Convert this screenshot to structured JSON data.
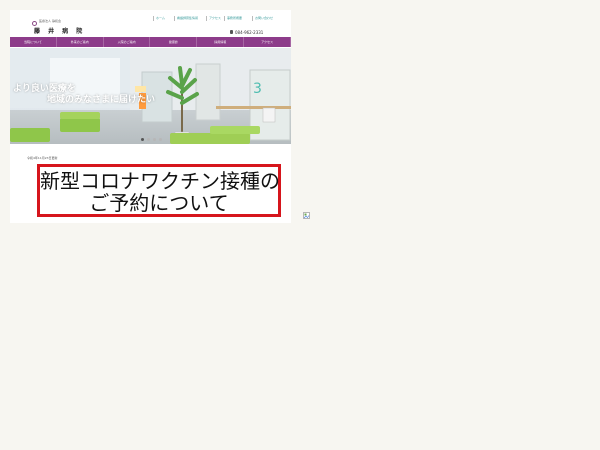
{
  "header": {
    "org_line": "医療法人 静和会",
    "logo_name": "藤 井 病 院",
    "phone": "084-962-2331",
    "utility_links": [
      "ホーム",
      "看護師募集情報",
      "アクセス",
      "事務所概要",
      "お問い合わせ"
    ]
  },
  "nav": {
    "items": [
      "当院について",
      "外来のご案内",
      "入院のご案内",
      "健康診",
      "採用情報",
      "アクセス"
    ]
  },
  "hero": {
    "line1": "より良い医療を",
    "line2": "地域のみなさまに届けたい",
    "door_number": "3"
  },
  "news": {
    "date": "令和4年11月23日更新",
    "headline_line1": "新型コロナワクチン接種の",
    "headline_line2": "ご予約について"
  },
  "colors": {
    "nav_purple": "#8d3c8a",
    "notice_border": "#d6151c",
    "page_bg": "#f7f6f1"
  }
}
